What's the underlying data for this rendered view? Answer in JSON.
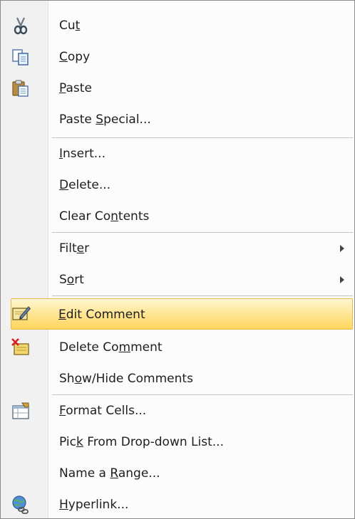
{
  "menu": {
    "items": [
      {
        "id": "cut",
        "pre": "Cu",
        "ul": "t",
        "post": "",
        "icon": "scissors-icon"
      },
      {
        "id": "copy",
        "pre": "",
        "ul": "C",
        "post": "opy",
        "icon": "copy-icon"
      },
      {
        "id": "paste",
        "pre": "",
        "ul": "P",
        "post": "aste",
        "icon": "paste-icon"
      },
      {
        "id": "paste-special",
        "pre": "Paste ",
        "ul": "S",
        "post": "pecial...",
        "icon": ""
      },
      {
        "id": "insert",
        "pre": "",
        "ul": "I",
        "post": "nsert...",
        "icon": ""
      },
      {
        "id": "delete",
        "pre": "",
        "ul": "D",
        "post": "elete...",
        "icon": ""
      },
      {
        "id": "clear-contents",
        "pre": "Clear Co",
        "ul": "n",
        "post": "tents",
        "icon": ""
      },
      {
        "id": "filter",
        "pre": "Filt",
        "ul": "e",
        "post": "r",
        "icon": "",
        "submenu": true
      },
      {
        "id": "sort",
        "pre": "S",
        "ul": "o",
        "post": "rt",
        "icon": "",
        "submenu": true
      },
      {
        "id": "edit-comment",
        "pre": "",
        "ul": "E",
        "post": "dit Comment",
        "icon": "edit-comment-icon",
        "highlighted": true
      },
      {
        "id": "delete-comment",
        "pre": "Delete Co",
        "ul": "m",
        "post": "ment",
        "icon": "delete-comment-icon"
      },
      {
        "id": "show-hide-comments",
        "pre": "Sh",
        "ul": "o",
        "post": "w/Hide Comments",
        "icon": ""
      },
      {
        "id": "format-cells",
        "pre": "",
        "ul": "F",
        "post": "ormat Cells...",
        "icon": "format-cells-icon"
      },
      {
        "id": "pick-from-dropdown",
        "pre": "Pic",
        "ul": "k",
        "post": " From Drop-down List...",
        "icon": ""
      },
      {
        "id": "name-a-range",
        "pre": "Name a ",
        "ul": "R",
        "post": "ange...",
        "icon": ""
      },
      {
        "id": "hyperlink",
        "pre": "",
        "ul": "H",
        "post": "yperlink...",
        "icon": "hyperlink-icon"
      }
    ]
  }
}
